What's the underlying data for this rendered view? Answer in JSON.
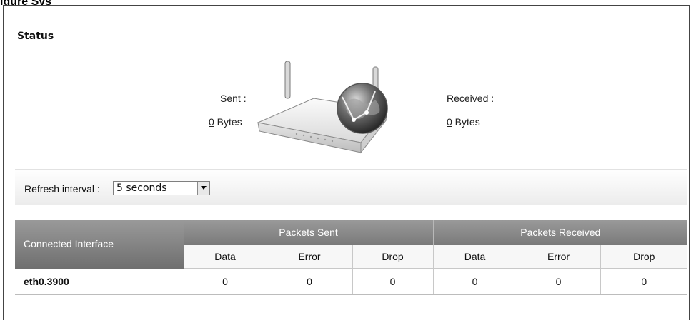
{
  "header": {
    "top_fragment": "igure Sys"
  },
  "status": {
    "title": "Status",
    "sent_label": "Sent :",
    "sent_value": "0",
    "sent_unit": " Bytes",
    "received_label": "Received :",
    "received_value": "0",
    "received_unit": " Bytes"
  },
  "refresh": {
    "label": "Refresh interval :",
    "selected": "5 seconds"
  },
  "table": {
    "col_connected": "Connected Interface",
    "group_sent": "Packets Sent",
    "group_received": "Packets Received",
    "sub_headers": [
      "Data",
      "Error",
      "Drop",
      "Data",
      "Error",
      "Drop"
    ],
    "rows": [
      {
        "interface": "eth0.3900",
        "values": [
          "0",
          "0",
          "0",
          "0",
          "0",
          "0"
        ]
      }
    ]
  },
  "icons": [
    "router-icon",
    "globe-icon",
    "dropdown-arrow-icon"
  ]
}
